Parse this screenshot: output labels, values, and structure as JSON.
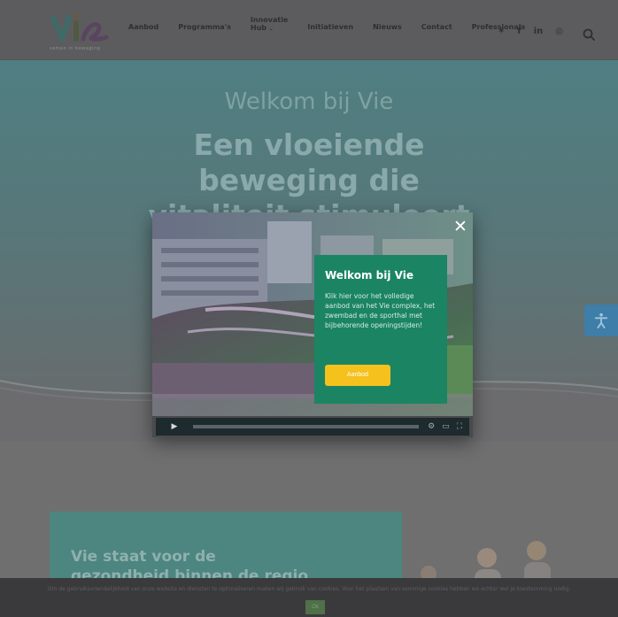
{
  "header": {
    "logo_tagline": "samen in beweging",
    "nav": [
      {
        "label": "Aanbod"
      },
      {
        "label": "Programma's"
      },
      {
        "label": "Innovatie",
        "label2": "Hub"
      },
      {
        "label": "Initiatieven"
      },
      {
        "label": "Nieuws"
      },
      {
        "label": "Contact"
      },
      {
        "label": "Professionals"
      }
    ],
    "social_icons": [
      "twitter-icon",
      "facebook-icon",
      "linkedin-icon",
      "instagram-icon"
    ],
    "social_glyphs": [
      "✶",
      "f",
      "in",
      "◎"
    ]
  },
  "hero": {
    "subtitle": "Welkom bij Vie",
    "title_lines": [
      "Een vloeiende",
      "beweging die",
      "vitaliteit stimuleert"
    ]
  },
  "modal": {
    "title": "Welkom bij Vie",
    "text": "Klik hier voor het volledige aanbod van het Vie complex, het zwembad en de sporthal met bijbehorende openingstijden!",
    "button_label": "Aanbod",
    "close_glyph": "✕",
    "play_glyph": "▶"
  },
  "section": {
    "title_lines": [
      "Vie staat voor de",
      "gezondheid binnen de regio"
    ]
  },
  "cookie": {
    "text": "Om de gebruiksvriendelijkheid van onze website en diensten te optimaliseren maken wij gebruik van cookies. Voor het plaatsen van sommige cookies hebben we echter wel je toestemming nodig.",
    "ok_label": "Ok"
  },
  "accessibility": {
    "glyph": "⚖"
  },
  "colors": {
    "promo_bg": "#1b8463",
    "promo_button": "#f4c11d",
    "header_overlay": "#5c5c5e",
    "teal": "#4d8580"
  }
}
